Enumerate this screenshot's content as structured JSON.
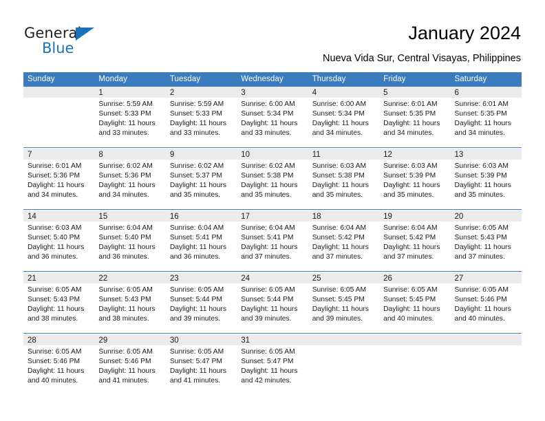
{
  "logo": {
    "word1": "General",
    "word2": "Blue",
    "triangle_color": "#1b72b8"
  },
  "header": {
    "title": "January 2024",
    "subtitle": "Nueva Vida Sur, Central Visayas, Philippines",
    "accent_color": "#3a7cbe",
    "daynum_bg": "#ebebeb"
  },
  "calendar": {
    "weekday_headers": [
      "Sunday",
      "Monday",
      "Tuesday",
      "Wednesday",
      "Thursday",
      "Friday",
      "Saturday"
    ],
    "weeks": [
      [
        {
          "day": "",
          "sunrise": "",
          "sunset": "",
          "daylight1": "",
          "daylight2": ""
        },
        {
          "day": "1",
          "sunrise": "Sunrise: 5:59 AM",
          "sunset": "Sunset: 5:33 PM",
          "daylight1": "Daylight: 11 hours",
          "daylight2": "and 33 minutes."
        },
        {
          "day": "2",
          "sunrise": "Sunrise: 5:59 AM",
          "sunset": "Sunset: 5:33 PM",
          "daylight1": "Daylight: 11 hours",
          "daylight2": "and 33 minutes."
        },
        {
          "day": "3",
          "sunrise": "Sunrise: 6:00 AM",
          "sunset": "Sunset: 5:34 PM",
          "daylight1": "Daylight: 11 hours",
          "daylight2": "and 33 minutes."
        },
        {
          "day": "4",
          "sunrise": "Sunrise: 6:00 AM",
          "sunset": "Sunset: 5:34 PM",
          "daylight1": "Daylight: 11 hours",
          "daylight2": "and 34 minutes."
        },
        {
          "day": "5",
          "sunrise": "Sunrise: 6:01 AM",
          "sunset": "Sunset: 5:35 PM",
          "daylight1": "Daylight: 11 hours",
          "daylight2": "and 34 minutes."
        },
        {
          "day": "6",
          "sunrise": "Sunrise: 6:01 AM",
          "sunset": "Sunset: 5:35 PM",
          "daylight1": "Daylight: 11 hours",
          "daylight2": "and 34 minutes."
        }
      ],
      [
        {
          "day": "7",
          "sunrise": "Sunrise: 6:01 AM",
          "sunset": "Sunset: 5:36 PM",
          "daylight1": "Daylight: 11 hours",
          "daylight2": "and 34 minutes."
        },
        {
          "day": "8",
          "sunrise": "Sunrise: 6:02 AM",
          "sunset": "Sunset: 5:36 PM",
          "daylight1": "Daylight: 11 hours",
          "daylight2": "and 34 minutes."
        },
        {
          "day": "9",
          "sunrise": "Sunrise: 6:02 AM",
          "sunset": "Sunset: 5:37 PM",
          "daylight1": "Daylight: 11 hours",
          "daylight2": "and 35 minutes."
        },
        {
          "day": "10",
          "sunrise": "Sunrise: 6:02 AM",
          "sunset": "Sunset: 5:38 PM",
          "daylight1": "Daylight: 11 hours",
          "daylight2": "and 35 minutes."
        },
        {
          "day": "11",
          "sunrise": "Sunrise: 6:03 AM",
          "sunset": "Sunset: 5:38 PM",
          "daylight1": "Daylight: 11 hours",
          "daylight2": "and 35 minutes."
        },
        {
          "day": "12",
          "sunrise": "Sunrise: 6:03 AM",
          "sunset": "Sunset: 5:39 PM",
          "daylight1": "Daylight: 11 hours",
          "daylight2": "and 35 minutes."
        },
        {
          "day": "13",
          "sunrise": "Sunrise: 6:03 AM",
          "sunset": "Sunset: 5:39 PM",
          "daylight1": "Daylight: 11 hours",
          "daylight2": "and 35 minutes."
        }
      ],
      [
        {
          "day": "14",
          "sunrise": "Sunrise: 6:03 AM",
          "sunset": "Sunset: 5:40 PM",
          "daylight1": "Daylight: 11 hours",
          "daylight2": "and 36 minutes."
        },
        {
          "day": "15",
          "sunrise": "Sunrise: 6:04 AM",
          "sunset": "Sunset: 5:40 PM",
          "daylight1": "Daylight: 11 hours",
          "daylight2": "and 36 minutes."
        },
        {
          "day": "16",
          "sunrise": "Sunrise: 6:04 AM",
          "sunset": "Sunset: 5:41 PM",
          "daylight1": "Daylight: 11 hours",
          "daylight2": "and 36 minutes."
        },
        {
          "day": "17",
          "sunrise": "Sunrise: 6:04 AM",
          "sunset": "Sunset: 5:41 PM",
          "daylight1": "Daylight: 11 hours",
          "daylight2": "and 37 minutes."
        },
        {
          "day": "18",
          "sunrise": "Sunrise: 6:04 AM",
          "sunset": "Sunset: 5:42 PM",
          "daylight1": "Daylight: 11 hours",
          "daylight2": "and 37 minutes."
        },
        {
          "day": "19",
          "sunrise": "Sunrise: 6:04 AM",
          "sunset": "Sunset: 5:42 PM",
          "daylight1": "Daylight: 11 hours",
          "daylight2": "and 37 minutes."
        },
        {
          "day": "20",
          "sunrise": "Sunrise: 6:05 AM",
          "sunset": "Sunset: 5:43 PM",
          "daylight1": "Daylight: 11 hours",
          "daylight2": "and 37 minutes."
        }
      ],
      [
        {
          "day": "21",
          "sunrise": "Sunrise: 6:05 AM",
          "sunset": "Sunset: 5:43 PM",
          "daylight1": "Daylight: 11 hours",
          "daylight2": "and 38 minutes."
        },
        {
          "day": "22",
          "sunrise": "Sunrise: 6:05 AM",
          "sunset": "Sunset: 5:43 PM",
          "daylight1": "Daylight: 11 hours",
          "daylight2": "and 38 minutes."
        },
        {
          "day": "23",
          "sunrise": "Sunrise: 6:05 AM",
          "sunset": "Sunset: 5:44 PM",
          "daylight1": "Daylight: 11 hours",
          "daylight2": "and 39 minutes."
        },
        {
          "day": "24",
          "sunrise": "Sunrise: 6:05 AM",
          "sunset": "Sunset: 5:44 PM",
          "daylight1": "Daylight: 11 hours",
          "daylight2": "and 39 minutes."
        },
        {
          "day": "25",
          "sunrise": "Sunrise: 6:05 AM",
          "sunset": "Sunset: 5:45 PM",
          "daylight1": "Daylight: 11 hours",
          "daylight2": "and 39 minutes."
        },
        {
          "day": "26",
          "sunrise": "Sunrise: 6:05 AM",
          "sunset": "Sunset: 5:45 PM",
          "daylight1": "Daylight: 11 hours",
          "daylight2": "and 40 minutes."
        },
        {
          "day": "27",
          "sunrise": "Sunrise: 6:05 AM",
          "sunset": "Sunset: 5:46 PM",
          "daylight1": "Daylight: 11 hours",
          "daylight2": "and 40 minutes."
        }
      ],
      [
        {
          "day": "28",
          "sunrise": "Sunrise: 6:05 AM",
          "sunset": "Sunset: 5:46 PM",
          "daylight1": "Daylight: 11 hours",
          "daylight2": "and 40 minutes."
        },
        {
          "day": "29",
          "sunrise": "Sunrise: 6:05 AM",
          "sunset": "Sunset: 5:46 PM",
          "daylight1": "Daylight: 11 hours",
          "daylight2": "and 41 minutes."
        },
        {
          "day": "30",
          "sunrise": "Sunrise: 6:05 AM",
          "sunset": "Sunset: 5:47 PM",
          "daylight1": "Daylight: 11 hours",
          "daylight2": "and 41 minutes."
        },
        {
          "day": "31",
          "sunrise": "Sunrise: 6:05 AM",
          "sunset": "Sunset: 5:47 PM",
          "daylight1": "Daylight: 11 hours",
          "daylight2": "and 42 minutes."
        },
        {
          "day": "",
          "sunrise": "",
          "sunset": "",
          "daylight1": "",
          "daylight2": ""
        },
        {
          "day": "",
          "sunrise": "",
          "sunset": "",
          "daylight1": "",
          "daylight2": ""
        },
        {
          "day": "",
          "sunrise": "",
          "sunset": "",
          "daylight1": "",
          "daylight2": ""
        }
      ]
    ]
  }
}
